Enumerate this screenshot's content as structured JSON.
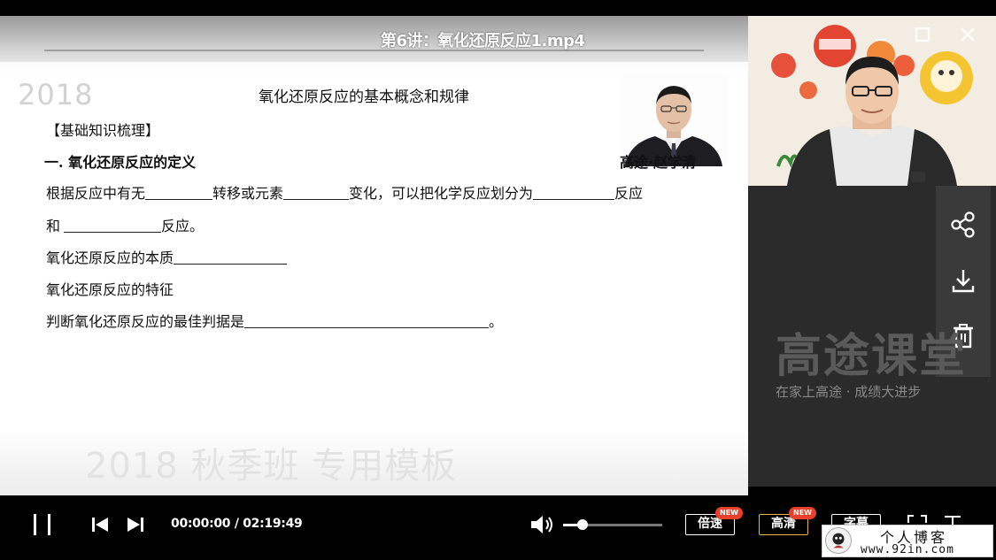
{
  "window": {
    "title": "第6讲：氧化还原反应1.mp4",
    "minimize_icon": "minimize-icon",
    "maximize_icon": "maximize-icon",
    "close_icon": "close-icon"
  },
  "slide": {
    "year": "2018",
    "title": "氧化还原反应的基本概念和规律",
    "section": "【基础知识梳理】",
    "subsection": "一. 氧化还原反应的定义",
    "teacher": "高途·赵学清",
    "lines": {
      "l1_a": "根据反应中有无",
      "l1_b": "转移或元素",
      "l1_c": "变化，可以把化学反应划分为",
      "l1_d": "反应",
      "l2_a": "和",
      "l2_b": "反应。",
      "l3": "氧化还原反应的本质",
      "l4": "氧化还原反应的特征",
      "l5_a": "判断氧化还原反应的最佳判据是",
      "l5_b": "。"
    },
    "watermark": "2018 秋季班 专用模板"
  },
  "side_panel": {
    "brand": "高途课堂",
    "slogan": "在家上高途 · 成绩大进步",
    "tools": [
      "share-icon",
      "download-icon",
      "trash-icon"
    ]
  },
  "player": {
    "time": "00:00:00 / 02:19:49",
    "volume_fraction": 0.2,
    "speed_label": "倍速",
    "quality_label": "高清",
    "subtitle_label": "字幕",
    "new_badge": "NEW"
  },
  "blog": {
    "title": "个人博客",
    "url": "www.92in.com"
  }
}
